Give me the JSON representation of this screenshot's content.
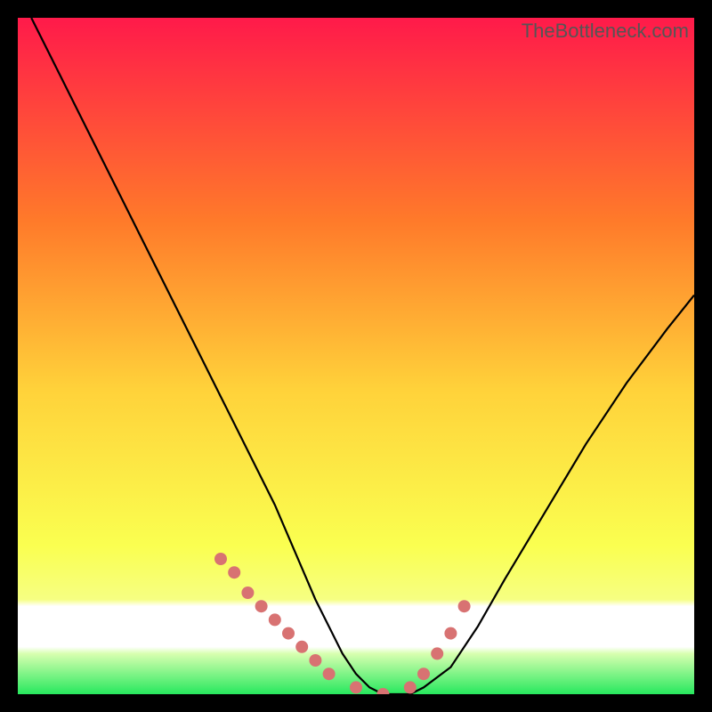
{
  "watermark": "TheBottleneck.com",
  "colors": {
    "black": "#000000",
    "curve": "#000000",
    "markers": "#d87272",
    "green": "#27e85e",
    "gradient_top": "#ff1a4a",
    "gradient_mid1": "#ff8a2a",
    "gradient_mid2": "#ffe43a",
    "gradient_mid3": "#f8ff66",
    "white_band": "#ffffff"
  },
  "chart_data": {
    "type": "line",
    "title": "",
    "xlabel": "",
    "ylabel": "",
    "xlim": [
      0,
      100
    ],
    "ylim": [
      0,
      100
    ],
    "series": [
      {
        "name": "bottleneck-curve",
        "x": [
          2,
          4,
          6,
          10,
          14,
          18,
          22,
          26,
          30,
          34,
          38,
          41,
          44,
          46,
          48,
          50,
          52,
          54,
          56,
          58,
          60,
          64,
          68,
          72,
          78,
          84,
          90,
          96,
          100
        ],
        "y": [
          100,
          96,
          92,
          84,
          76,
          68,
          60,
          52,
          44,
          36,
          28,
          21,
          14,
          10,
          6,
          3,
          1,
          0,
          0,
          0,
          1,
          4,
          10,
          17,
          27,
          37,
          46,
          54,
          59
        ]
      }
    ],
    "markers": {
      "name": "highlighted-points",
      "x": [
        30,
        32,
        34,
        36,
        38,
        40,
        42,
        44,
        46,
        50,
        54,
        58,
        60,
        62,
        64,
        66
      ],
      "y": [
        20,
        18,
        15,
        13,
        11,
        9,
        7,
        5,
        3,
        1,
        0,
        1,
        3,
        6,
        9,
        13
      ]
    },
    "bands": [
      {
        "name": "white-band",
        "y_from": 87.5,
        "y_to": 93.5
      },
      {
        "name": "green-band",
        "y_from": 95,
        "y_to": 100
      }
    ]
  }
}
